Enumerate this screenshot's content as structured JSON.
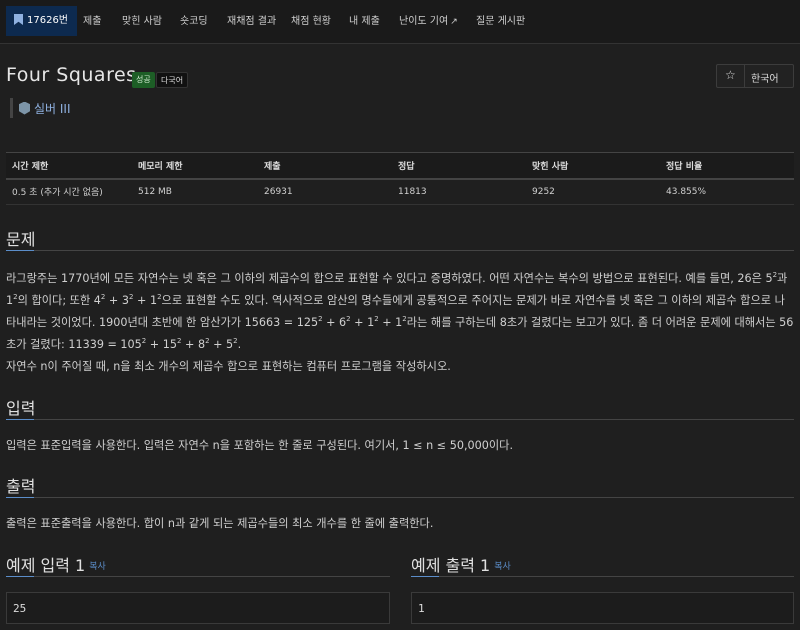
{
  "nav": {
    "problem_id": "17626번",
    "submit": "제출",
    "solved_by": "맞힌 사람",
    "short_coding": "숏코딩",
    "rejudge_results": "재채점 결과",
    "judge_status": "채점 현황",
    "my_submissions": "내 제출",
    "difficulty": "난이도 기여",
    "qna": "질문 게시판"
  },
  "problem": {
    "title": "Four Squares",
    "label_success": "성공",
    "label_multilang": "다국어",
    "tier": "실버 III",
    "language": "한국어"
  },
  "info_table": {
    "headers": [
      "시간 제한",
      "메모리 제한",
      "제출",
      "정답",
      "맞힌 사람",
      "정답 비율"
    ],
    "values": [
      "0.5 초 (추가 시간 없음)",
      "512 MB",
      "26931",
      "11813",
      "9252",
      "43.855%"
    ]
  },
  "sections": {
    "problem_heading": "문제",
    "input_heading": "입력",
    "output_heading": "출력",
    "input_text": "입력은 표준입력을 사용한다. 입력은 자연수 n을 포함하는 한 줄로 구성된다. 여기서, 1 ≤ n ≤ 50,000이다.",
    "output_text": "출력은 표준출력을 사용한다. 합이 n과 같게 되는 제곱수들의 최소 개수를 한 줄에 출력한다.",
    "problem_p2": "자연수 n이 주어질 때, n을 최소 개수의 제곱수 합으로 표현하는 컴퓨터 프로그램을 작성하시오."
  },
  "samples": {
    "input_title": "예제 입력 1",
    "output_title": "예제 출력 1",
    "copy": "복사",
    "input_value": "25",
    "output_value": "1"
  },
  "colors": {
    "accent": "#5b8dc9",
    "nav_active": "#0d2a4f",
    "success": "#1d5e26"
  }
}
